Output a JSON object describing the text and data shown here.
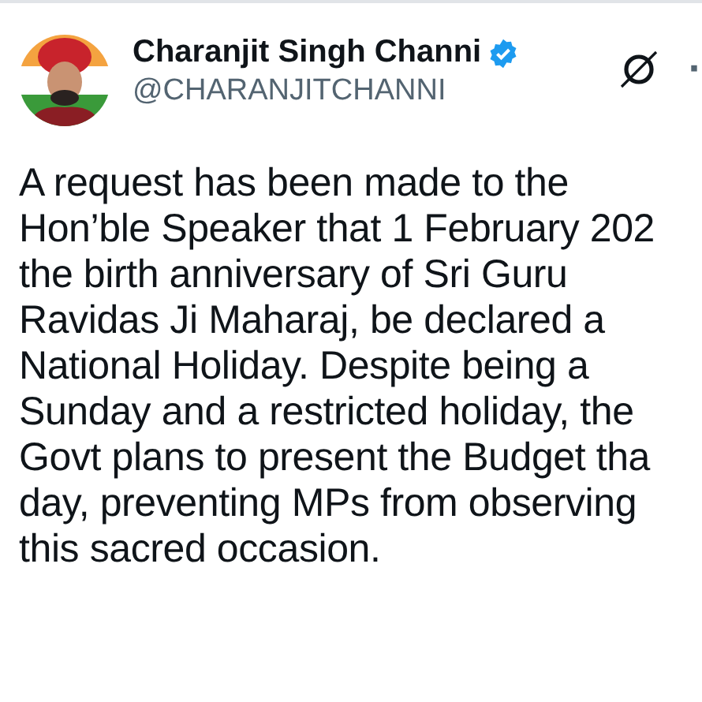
{
  "author": {
    "name": "Charanjit Singh Channi",
    "verified": true,
    "handle": "@CHARANJITCHANNI"
  },
  "menu": "·",
  "body": "A request has been made to the\nHon’ble Speaker that 1 February 202\nthe birth anniversary of Sri Guru\nRavidas Ji Maharaj, be declared a\nNational Holiday. Despite being a\nSunday and a restricted holiday, the\nGovt plans to present the Budget tha\nday, preventing MPs from observing\nthis sacred occasion."
}
